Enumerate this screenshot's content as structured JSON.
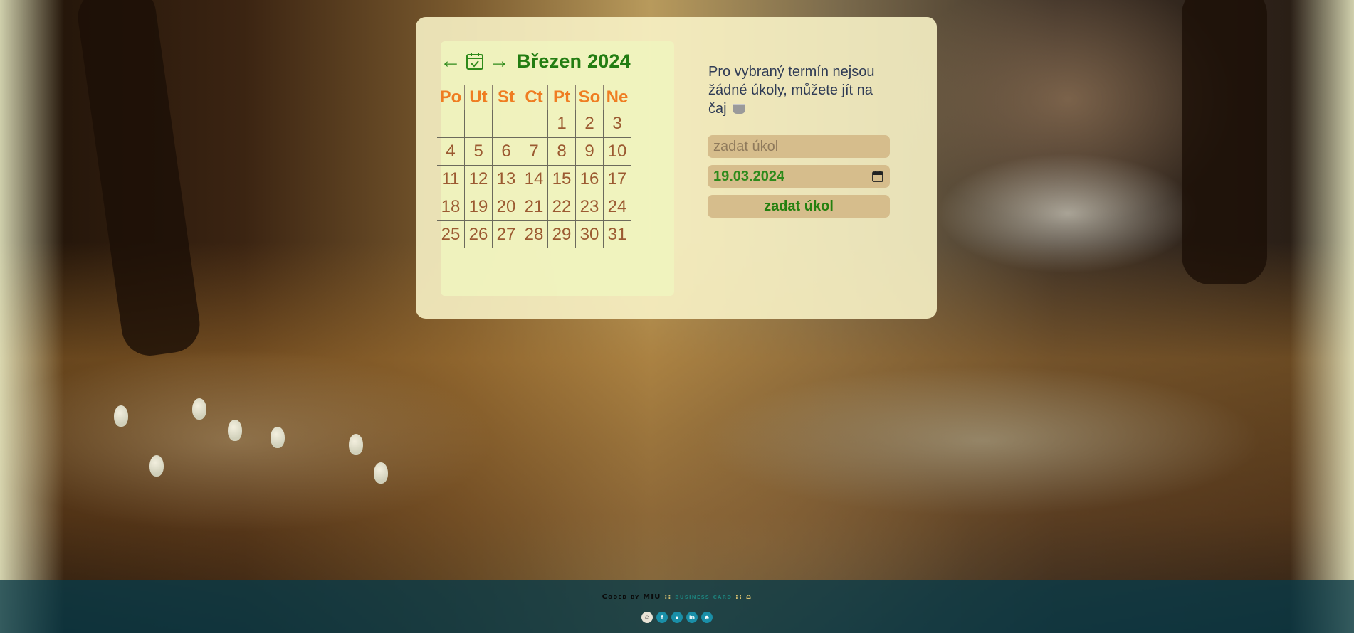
{
  "calendar": {
    "prev_arrow": "←",
    "next_arrow": "→",
    "month": "Březen",
    "year": "2024",
    "weekdays": [
      "Po",
      "Ut",
      "St",
      "Ct",
      "Pt",
      "So",
      "Ne"
    ],
    "weeks": [
      [
        "",
        "",
        "",
        "",
        "1",
        "2",
        "3"
      ],
      [
        "4",
        "5",
        "6",
        "7",
        "8",
        "9",
        "10"
      ],
      [
        "11",
        "12",
        "13",
        "14",
        "15",
        "16",
        "17"
      ],
      [
        "18",
        "19",
        "20",
        "21",
        "22",
        "23",
        "24"
      ],
      [
        "25",
        "26",
        "27",
        "28",
        "29",
        "30",
        "31"
      ]
    ]
  },
  "tasks": {
    "empty_message": "Pro vybraný termín nejsou žádné úkoly, můžete jít na čaj",
    "task_placeholder": "zadat úkol",
    "date_value": "19.03.2024",
    "add_button_label": "zadat úkol"
  },
  "footer": {
    "coded_by": "Coded by MIU",
    "separator": "::",
    "business_card": "business card",
    "trailing": ":: ⌂",
    "icons": [
      "avatar-icon",
      "facebook-icon",
      "github-icon",
      "linkedin-icon",
      "discord-icon"
    ]
  },
  "colors": {
    "accent_green": "#237d12",
    "weekday_orange": "#ef7d22",
    "day_brown": "#9b5a31",
    "input_bg": "#d6bd8c",
    "footer_bg": "#083a48"
  }
}
